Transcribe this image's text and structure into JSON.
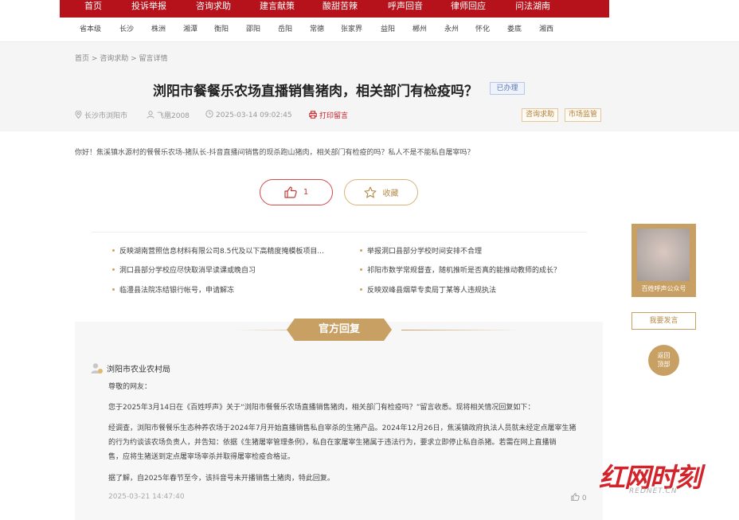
{
  "nav": [
    "首页",
    "投诉举报",
    "咨询求助",
    "建言献策",
    "酸甜苦辣",
    "呼声回音",
    "律师回应",
    "问法湖南"
  ],
  "cities": [
    "省本级",
    "长沙",
    "株洲",
    "湘潭",
    "衡阳",
    "邵阳",
    "岳阳",
    "常德",
    "张家界",
    "益阳",
    "郴州",
    "永州",
    "怀化",
    "娄底",
    "湘西"
  ],
  "breadcrumb": "首页 > 咨询求助 > 留言详情",
  "title": "浏阳市餐餐乐农场直播销售猪肉，相关部门有检疫吗？",
  "status_badge": "已办理",
  "meta": {
    "location": "长沙市浏阳市",
    "author": "飞凰2008",
    "time": "2025-03-14 09:02:45",
    "print": "打印留言"
  },
  "tags": [
    "咨询求助",
    "市场监管"
  ],
  "question": "你好！焦溪镇水源村的餐餐乐农场-猪队长-抖音直播间销售的现杀跑山猪肉，相关部门有检疫的吗？私人不是不能私自屠宰吗？",
  "actions": {
    "like_count": "1",
    "favorite": "收藏"
  },
  "related": [
    "反映湖南营照信息材料有限公司8.5代及以下高精度掩模板项目...",
    "举报洞口县部分学校时间安排不合理",
    "洞口县部分学校应尽快取消早读课或晚自习",
    "祁阳市数学常规督查，随机推听是否真的能推动教师的成长？",
    "临澧县法院冻结银行帐号，申请解冻",
    "反映双峰县烟草专卖局丁某等人违规执法"
  ],
  "sidebar": {
    "qr_label": "百姓呼声公众号",
    "post_button": "我要发言",
    "top_button": [
      "返回",
      "顶部"
    ]
  },
  "reply": {
    "badge": "官方回复",
    "department": "浏阳市农业农村局",
    "greeting": "尊敬的网友：",
    "p1": "您于2025年3月14日在《百姓呼声》关于“浏阳市餐餐乐农场直播销售猪肉，相关部门有检疫吗？”留言收悉。现将相关情况回复如下：",
    "p2a": "经调查，浏阳市餐餐乐生态种养农场于2024年7月开始直播销售私自宰杀的生猪产品。2024年12月26日，焦溪镇政府执法人员就未经定点屠宰生猪",
    "p2b": "的行为约谈该农场负责人，并告知：依据《生猪屠宰管理条例》，私自在家屠宰生猪属于违法行为，要求立即停止私自杀猪。若需在网上直播销",
    "p2c": "售，应将生猪送到定点屠宰场宰杀并取得屠宰检疫合格证。",
    "p3": "据了解，自2025年春节至今，该抖音号未开播销售土猪肉，特此回复。",
    "date": "2025-03-21 14:47:40",
    "likes": "0"
  },
  "watermark": {
    "logo": "红网时刻",
    "domain": "REDNET.CN"
  }
}
